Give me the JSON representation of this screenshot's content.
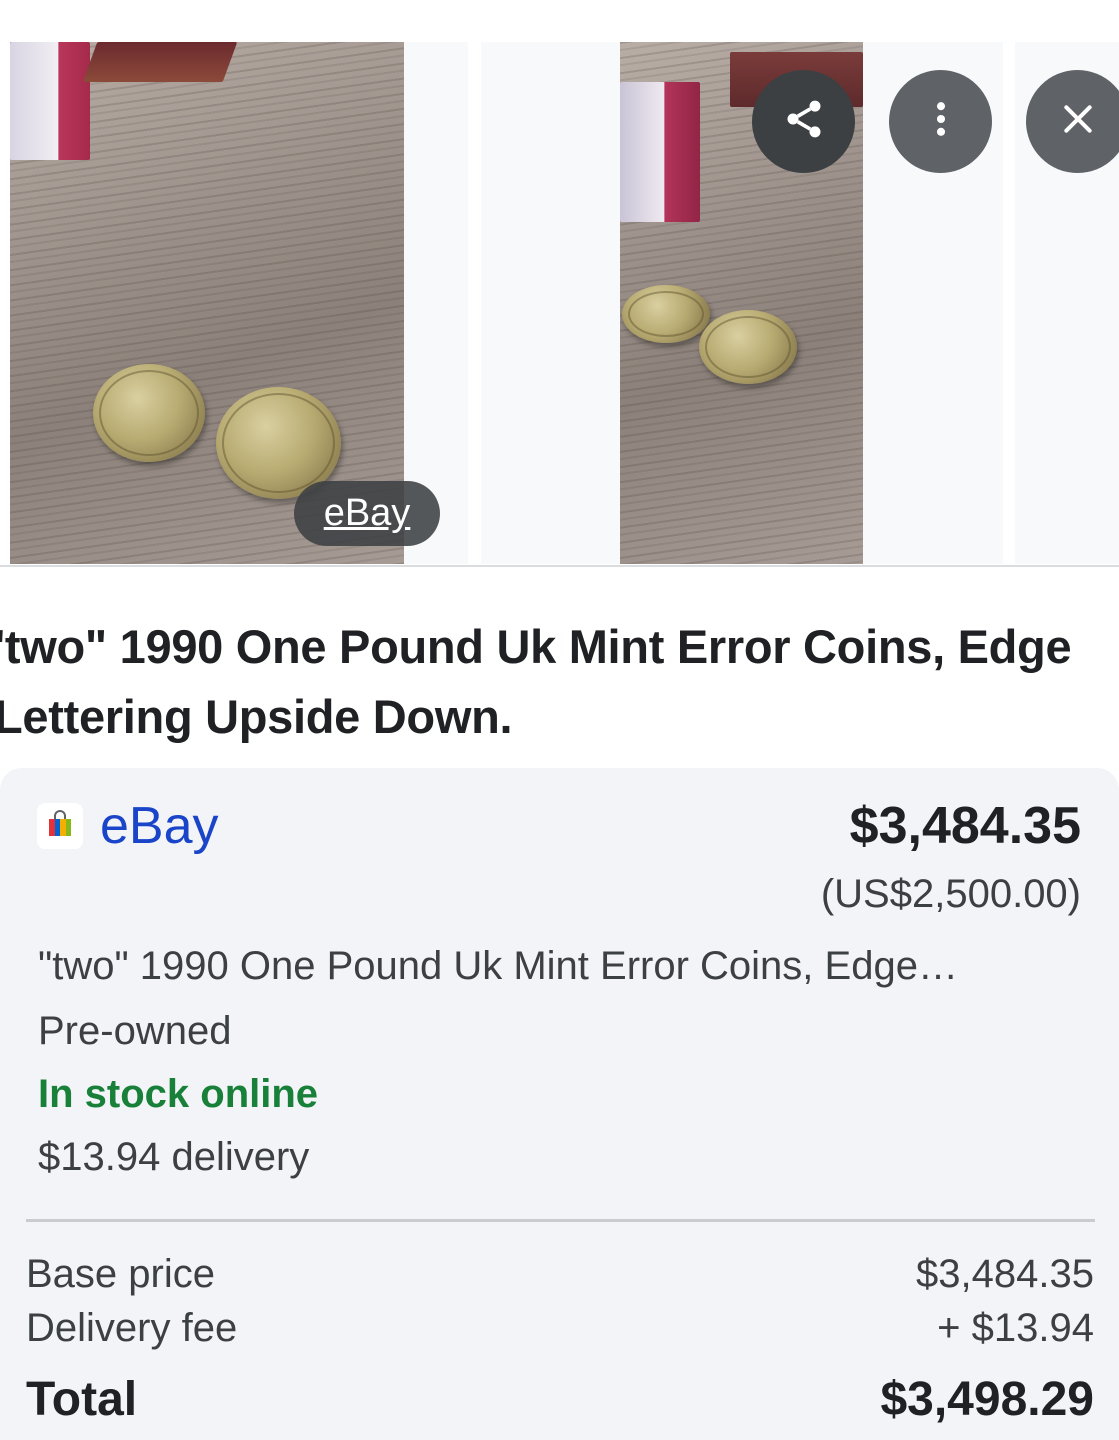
{
  "carousel": {
    "source_label": "eBay",
    "icons": {
      "share": "share-icon",
      "more": "more-vert-icon",
      "close": "close-icon"
    }
  },
  "item": {
    "title": "'two\" 1990 One Pound Uk Mint Error Coins, Edge Lettering Upside Down."
  },
  "offer": {
    "store_name": "eBay",
    "store_icon": "ebay-shopping-bag-icon",
    "price": "$3,484.35",
    "price_original": "(US$2,500.00)",
    "description": "\"two\" 1990 One Pound Uk Mint Error Coins, Edge…",
    "condition": "Pre-owned",
    "stock_status": "In stock online",
    "delivery": "$13.94 delivery"
  },
  "breakdown": {
    "base_label": "Base price",
    "base_value": "$3,484.35",
    "fee_label": "Delivery fee",
    "fee_value": "+ $13.94",
    "total_label": "Total",
    "total_value": "$3,498.29"
  },
  "colors": {
    "link_blue": "#1a45c9",
    "stock_green": "#188038",
    "card_bg": "#f3f4f8"
  }
}
